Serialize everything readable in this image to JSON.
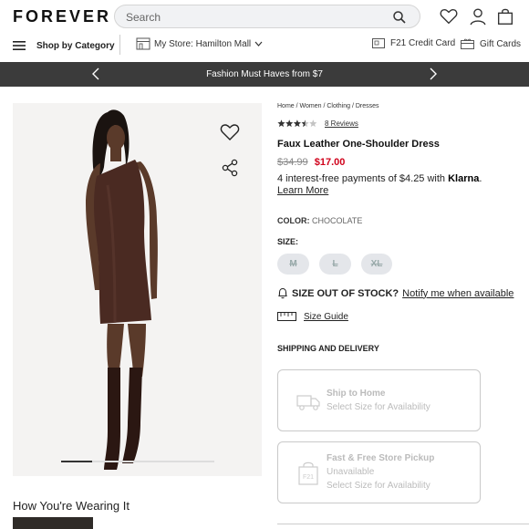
{
  "header": {
    "logo": "FOREVER 21",
    "search_placeholder": "Search",
    "shop_by_category": "Shop by Category",
    "store_label": "My Store: Hamilton Mall",
    "credit_card": "F21 Credit Card",
    "gift_cards": "Gift Cards"
  },
  "promo": {
    "text": "Fashion Must Haves from $7"
  },
  "product": {
    "breadcrumb": "Home / Women / Clothing / Dresses",
    "rating": 3.5,
    "reviews": "8 Reviews",
    "title": "Faux Leather One-Shoulder Dress",
    "old_price": "$34.99",
    "sale_price": "$17.00",
    "klarna_text": "4 interest-free payments of $4.25 with",
    "klarna_brand": "Klarna",
    "klarna_period": ".",
    "learn_more": "Learn More",
    "color_label": "COLOR:",
    "color_value": "CHOCOLATE",
    "size_label": "SIZE:",
    "sizes": [
      "M",
      "L",
      "XL"
    ],
    "oos_question": "SIZE OUT OF STOCK?",
    "notify": "Notify me when available",
    "size_guide": "Size Guide",
    "image_position": 1,
    "image_count": 5
  },
  "shipping": {
    "heading": "SHIPPING AND DELIVERY",
    "option1_title": "Ship to Home",
    "option1_sub": "Select Size for Availability",
    "option2_title": "Fast & Free Store Pickup",
    "option2_status": "Unavailable",
    "option2_sub": "Select Size for Availability"
  },
  "wearing": {
    "heading": "How You're Wearing It"
  },
  "colors": {
    "sale": "#d0021b",
    "promo_bg": "#3b3b3b",
    "dress": "#4a2a22"
  }
}
